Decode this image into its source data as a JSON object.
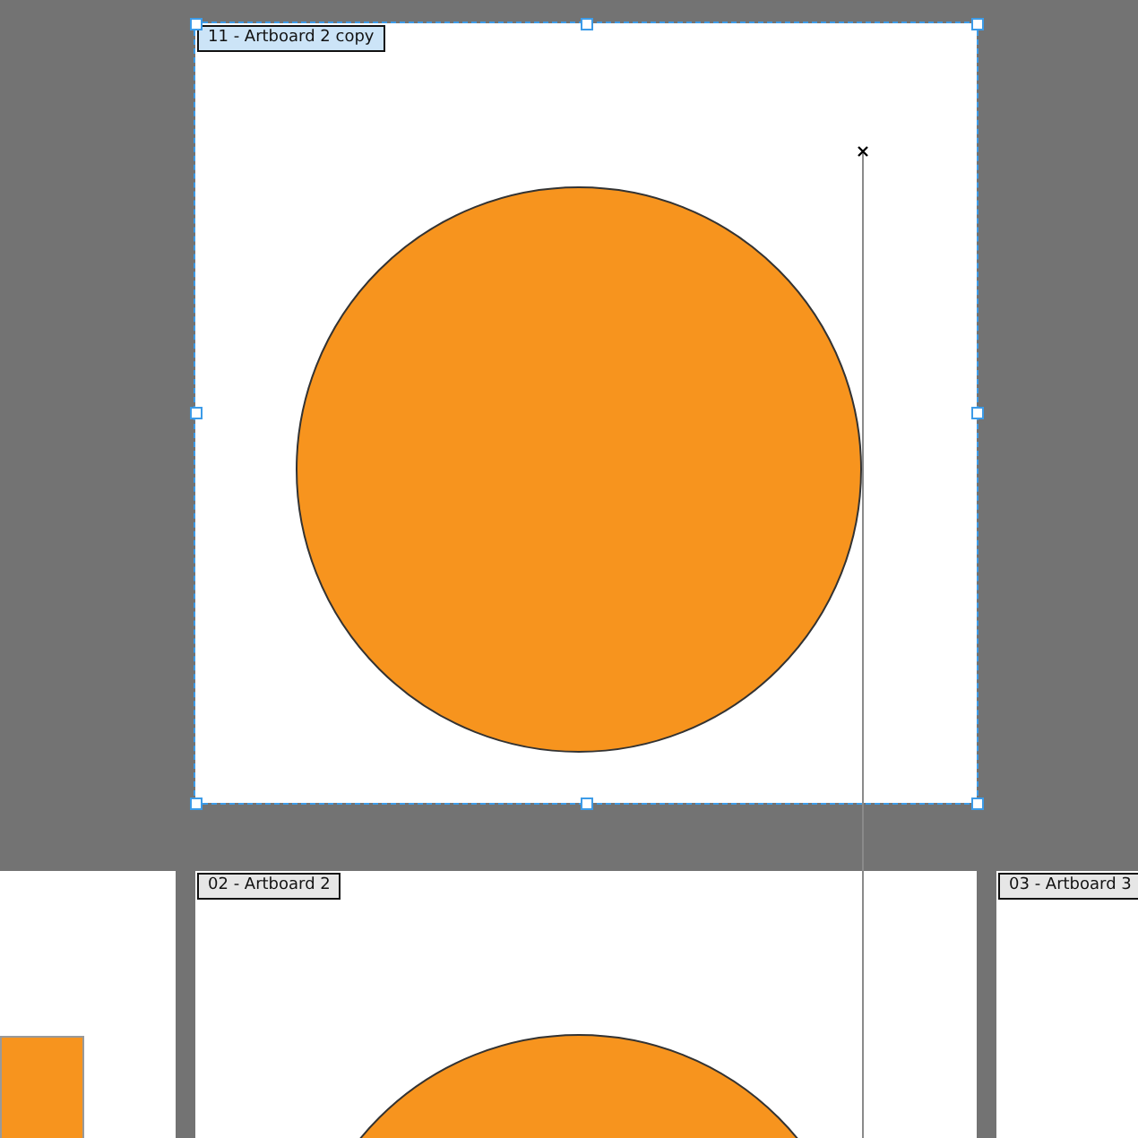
{
  "artboards": [
    {
      "label": "11 - Artboard 2 copy",
      "selected": true,
      "kind": "circle"
    },
    {
      "selected": false,
      "kind": "square"
    },
    {
      "label": "02 - Artboard 2",
      "selected": false,
      "kind": "circle"
    },
    {
      "label": "03 - Artboard 3",
      "selected": false,
      "kind": "empty"
    }
  ]
}
